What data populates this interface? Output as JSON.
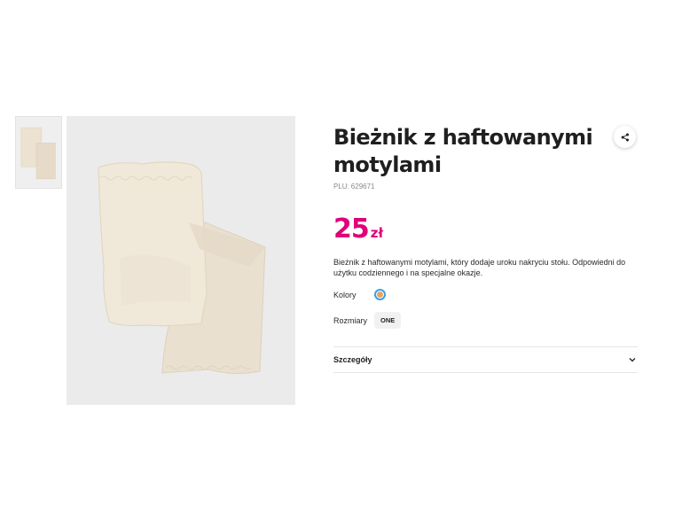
{
  "product": {
    "title": "Bieżnik z haftowanymi motylami",
    "plu_label": "PLU:",
    "plu_value": "629671",
    "price_amount": "25",
    "price_currency": "zł",
    "description": "Bieżnik z haftowanymi motylami, który dodaje uroku nakryciu stołu. Odpowiedni do użytku codziennego i na specjalne okazje.",
    "colors_label": "Kolory",
    "selected_color": "#e8a45c",
    "sizes_label": "Rozmiary",
    "sizes": [
      "ONE"
    ],
    "details_label": "Szczegóły"
  },
  "icons": {
    "share": "share-icon",
    "details_toggle": "chevron-down-icon"
  },
  "colors": {
    "price": "#e0007a",
    "swatch_ring": "#3aa0e8",
    "fabric": "#efe6d6"
  }
}
